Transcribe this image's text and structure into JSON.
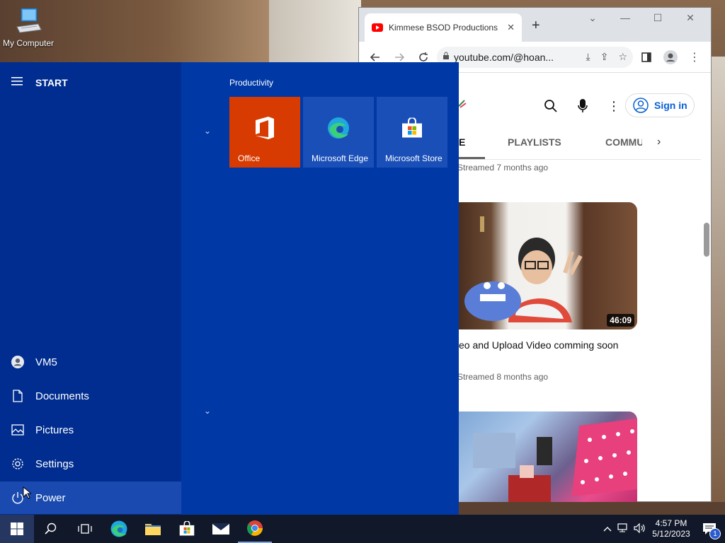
{
  "desktop": {
    "icon_label": "My Computer"
  },
  "browser": {
    "tab_title": "Kimmese BSOD Productions",
    "tab_close": "✕",
    "new_tab": "+",
    "url": "youtube.com/@hoan...",
    "youtube": {
      "signin_label": "Sign in",
      "tabs": [
        "E",
        "PLAYLISTS",
        "COMMU"
      ],
      "videos": [
        {
          "meta_above": "Streamed 7 months ago"
        },
        {
          "duration": "46:09",
          "title": "eo and Upload Video comming soon",
          "meta": "Streamed 8 months ago"
        }
      ]
    }
  },
  "start": {
    "header": "START",
    "section": "Productivity",
    "tiles": [
      {
        "label": "Office",
        "color": "#d83b01"
      },
      {
        "label": "Microsoft Edge",
        "color": "#1a4fb8"
      },
      {
        "label": "Microsoft Store",
        "color": "#1a4fb8"
      }
    ],
    "left_items": [
      {
        "label": "VM5",
        "icon": "user-icon"
      },
      {
        "label": "Documents",
        "icon": "document-icon"
      },
      {
        "label": "Pictures",
        "icon": "pictures-icon"
      },
      {
        "label": "Settings",
        "icon": "gear-icon"
      },
      {
        "label": "Power",
        "icon": "power-icon"
      }
    ]
  },
  "taskbar": {
    "time": "4:57 PM",
    "date": "5/12/2023",
    "notification_count": "1"
  },
  "colors": {
    "start_bg": "#0039a6",
    "start_left_bg": "#002d8f",
    "taskbar_bg": "#10182a",
    "office_tile": "#d83b01"
  }
}
